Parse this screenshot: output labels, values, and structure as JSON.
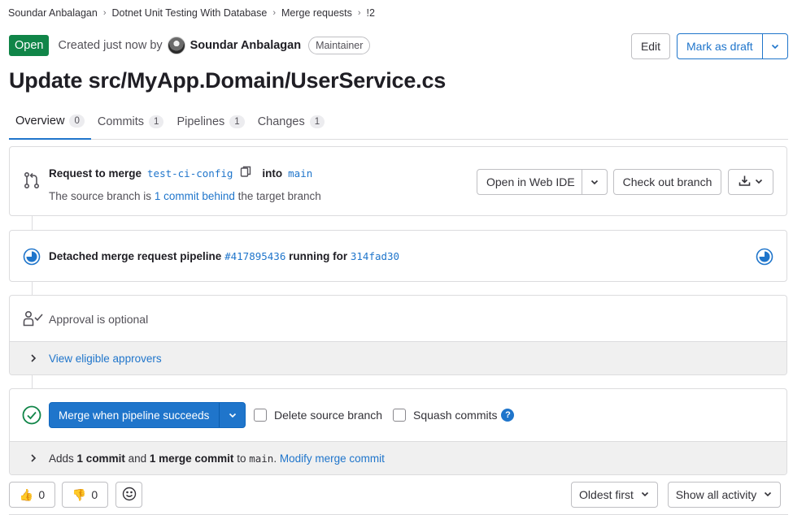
{
  "breadcrumb": [
    "Soundar Anbalagan",
    "Dotnet Unit Testing With Database",
    "Merge requests",
    "!2"
  ],
  "header": {
    "status": "Open",
    "created_text": "Created just now by",
    "author": "Soundar Anbalagan",
    "role": "Maintainer",
    "edit_label": "Edit",
    "draft_label": "Mark as draft"
  },
  "title": "Update src/MyApp.Domain/UserService.cs",
  "tabs": [
    {
      "label": "Overview",
      "count": "0"
    },
    {
      "label": "Commits",
      "count": "1"
    },
    {
      "label": "Pipelines",
      "count": "1"
    },
    {
      "label": "Changes",
      "count": "1"
    }
  ],
  "merge_request": {
    "prefix": "Request to merge",
    "source_branch": "test-ci-config",
    "into": "into",
    "target_branch": "main",
    "status_prefix": "The source branch is",
    "status_link": "1 commit behind",
    "status_suffix": "the target branch",
    "web_ide_label": "Open in Web IDE",
    "checkout_label": "Check out branch"
  },
  "pipeline": {
    "prefix": "Detached merge request pipeline",
    "id": "#417895436",
    "middle": "running for",
    "commit": "314fad30"
  },
  "approval": {
    "text": "Approval is optional",
    "link": "View eligible approvers"
  },
  "merge": {
    "button_label": "Merge when pipeline succeeds",
    "delete_label": "Delete source branch",
    "squash_label": "Squash commits",
    "help": "?",
    "info_pre": "Adds",
    "info_commit": "1 commit",
    "info_and": "and",
    "info_merge_commit": "1 merge commit",
    "info_to": "to",
    "info_branch": "main",
    "info_dot": ".",
    "info_link": "Modify merge commit"
  },
  "reactions": {
    "thumbsup": "👍",
    "thumbsup_count": "0",
    "thumbsdown": "👎",
    "thumbsdown_count": "0"
  },
  "sort": {
    "order_label": "Oldest first",
    "filter_label": "Show all activity"
  },
  "colors": {
    "accent": "#1f75cb",
    "success": "#108548",
    "border": "#dcdcde"
  }
}
